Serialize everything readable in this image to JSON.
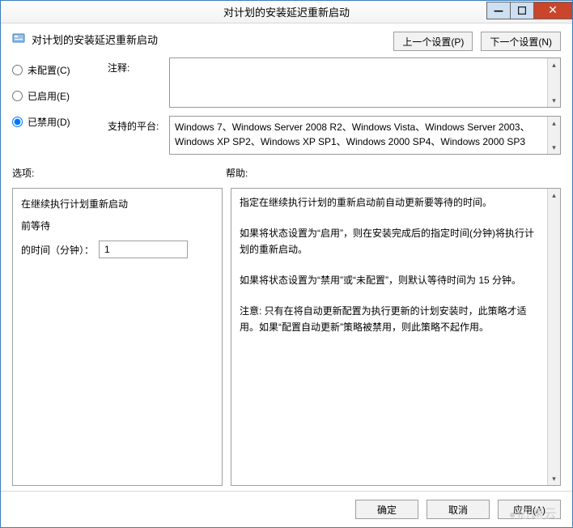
{
  "window": {
    "title": "对计划的安装延迟重新启动"
  },
  "header": {
    "title": "对计划的安装延迟重新启动",
    "prev_button": "上一个设置(P)",
    "next_button": "下一个设置(N)"
  },
  "state": {
    "selected": "disabled",
    "notconfigured_label": "未配置(C)",
    "enabled_label": "已启用(E)",
    "disabled_label": "已禁用(D)"
  },
  "comment": {
    "label": "注释:",
    "text": ""
  },
  "platforms": {
    "label": "支持的平台:",
    "text": "Windows 7、Windows Server 2008 R2、Windows Vista、Windows Server 2003、Windows XP SP2、Windows XP SP1、Windows 2000 SP4、Windows 2000 SP3"
  },
  "labels": {
    "options": "选项:",
    "help": "帮助:"
  },
  "options": {
    "line1": "在继续执行计划重新启动",
    "line2": "前等待",
    "minutes_label": "的时间（分钟）：",
    "minutes_value": "1"
  },
  "help": {
    "p1": "指定在继续执行计划的重新启动前自动更新要等待的时间。",
    "p2": "如果将状态设置为“启用”，则在安装完成后的指定时间(分钟)将执行计划的重新启动。",
    "p3": "如果将状态设置为“禁用”或“未配置”，则默认等待时间为 15 分钟。",
    "p4": "注意: 只有在将自动更新配置为执行更新的计划安装时，此策略才适用。如果“配置自动更新”策略被禁用，则此策略不起作用。"
  },
  "footer": {
    "ok": "确定",
    "cancel": "取消",
    "apply": "应用(A)"
  },
  "watermark": "亿速云"
}
